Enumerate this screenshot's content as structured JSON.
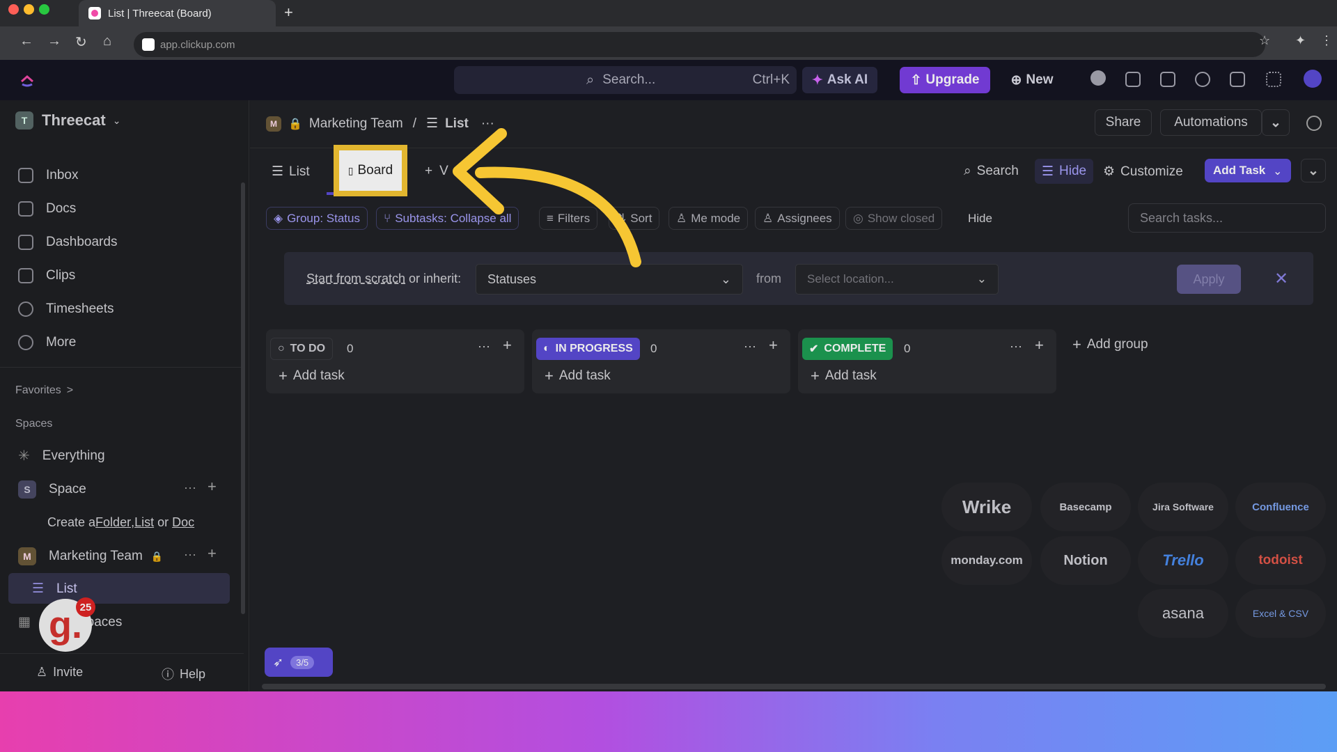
{
  "browser": {
    "tab_title": "List | Threecat (Board)",
    "new_tab": "+",
    "url": "app.clickup.com"
  },
  "topnav": {
    "search_placeholder": "Search...",
    "search_shortcut": "Ctrl+K",
    "ask_ai": "Ask AI",
    "upgrade": "Upgrade",
    "new": "New"
  },
  "sidebar": {
    "workspace": "Threecat",
    "workspace_initial": "T",
    "items": [
      {
        "label": "Inbox"
      },
      {
        "label": "Docs"
      },
      {
        "label": "Dashboards"
      },
      {
        "label": "Clips"
      },
      {
        "label": "Timesheets"
      },
      {
        "label": "More"
      }
    ],
    "favorites": "Favorites",
    "favorites_chevron": ">",
    "spaces": "Spaces",
    "everything": "Everything",
    "space_name": "Space",
    "space_initial": "S",
    "create_prefix": "Create a ",
    "create_folder": "Folder",
    "create_sep1": ", ",
    "create_list": "List",
    "create_or": " or ",
    "create_doc": "Doc",
    "team_name": "Marketing Team",
    "team_initial": "M",
    "list_name": "List",
    "spaces_bottom": "Spaces",
    "badge_count": "25",
    "invite": "Invite",
    "help": "Help"
  },
  "header": {
    "team_initial": "M",
    "breadcrumb_team": "Marketing Team",
    "breadcrumb_sep": "/",
    "breadcrumb_list": "List",
    "more": "···",
    "share": "Share",
    "automations": "Automations"
  },
  "views": {
    "list": "List",
    "board": "Board",
    "add_view": "V"
  },
  "toolbar": {
    "search": "Search",
    "hide": "Hide",
    "customize": "Customize",
    "add_task": "Add Task"
  },
  "filters": {
    "group": "Group: Status",
    "subtasks": "Subtasks: Collapse all",
    "filters": "Filters",
    "sort": "Sort",
    "me_mode": "Me mode",
    "assignees": "Assignees",
    "show_closed": "Show closed",
    "hide": "Hide",
    "search_placeholder": "Search tasks..."
  },
  "template_bar": {
    "start": "Start from scratch",
    "or_inherit": " or inherit:",
    "select_value": "Statuses",
    "from": "from",
    "location_placeholder": "Select location...",
    "apply": "Apply"
  },
  "columns": [
    {
      "status": "TO DO",
      "count": "0",
      "add_task": "Add task",
      "color": "#2b2c30"
    },
    {
      "status": "IN PROGRESS",
      "count": "0",
      "add_task": "Add task",
      "color": "#5b4bd6"
    },
    {
      "status": "COMPLETE",
      "count": "0",
      "add_task": "Add task",
      "color": "#1e9e54"
    }
  ],
  "add_group": "Add group",
  "integrations": [
    "Wrike",
    "Basecamp",
    "Jira Software",
    "Confluence",
    "monday.com",
    "Notion",
    "Trello",
    "todoist",
    "asana",
    "Excel & CSV"
  ],
  "onboarding_progress": "3/5",
  "colors": {
    "accent": "#5b4bd6",
    "highlight": "#f6c633",
    "upgrade": "#7b3fe4"
  }
}
